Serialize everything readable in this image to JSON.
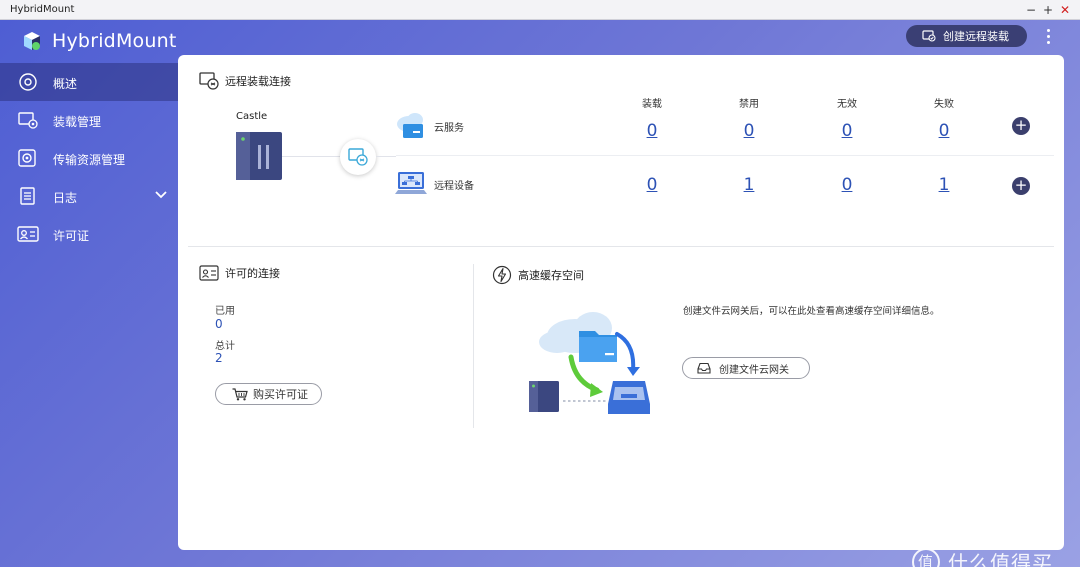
{
  "window": {
    "title": "HybridMount",
    "controls": [
      "−",
      "+",
      "✕"
    ]
  },
  "app": {
    "name": "HybridMount"
  },
  "header": {
    "create_remote_mount_label": "创建远程装载"
  },
  "sidebar": {
    "items": [
      {
        "label": "概述",
        "icon": "overview-icon",
        "active": true
      },
      {
        "label": "装载管理",
        "icon": "mount-management-icon"
      },
      {
        "label": "传输资源管理",
        "icon": "transfer-resource-icon"
      },
      {
        "label": "日志",
        "icon": "log-icon",
        "expandable": true
      },
      {
        "label": "许可证",
        "icon": "license-icon"
      }
    ]
  },
  "remote_connections": {
    "title": "远程装载连接",
    "device_name": "Castle",
    "columns": [
      "装载",
      "禁用",
      "无效",
      "失败"
    ],
    "rows": [
      {
        "label": "云服务",
        "icon": "cloud-service-icon",
        "values": [
          "0",
          "0",
          "0",
          "0"
        ]
      },
      {
        "label": "远程设备",
        "icon": "remote-device-icon",
        "values": [
          "0",
          "1",
          "0",
          "1"
        ]
      }
    ],
    "add_label": "+"
  },
  "licensed_connections": {
    "title": "许可的连接",
    "used_label": "已用",
    "used_value": "0",
    "total_label": "总计",
    "total_value": "2",
    "buy_label": "购买许可证"
  },
  "cache_space": {
    "title": "高速缓存空间",
    "description": "创建文件云网关后，可以在此处查看高速缓存空间详细信息。",
    "create_label": "创建文件云网关"
  },
  "watermark": {
    "text": "什么值得买",
    "logo": "值"
  },
  "colors": {
    "accent": "#2d52b5",
    "sidebar_grad_start": "#4e5ed3",
    "button_dark": "#3a3f74"
  }
}
